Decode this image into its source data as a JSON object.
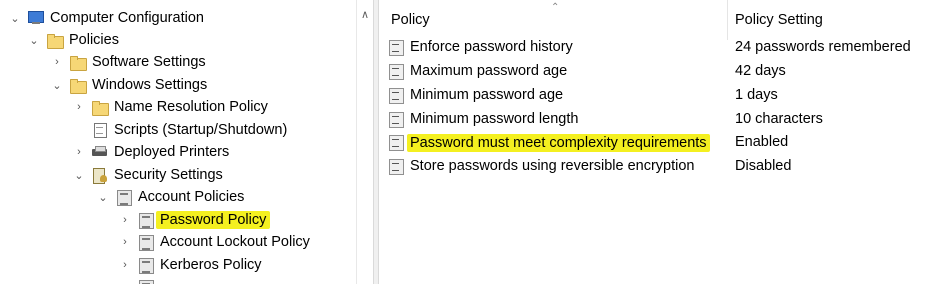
{
  "tree": {
    "nodes": [
      {
        "label": "Computer Configuration",
        "icon": "computer-icon",
        "expander": "expanded"
      },
      {
        "label": "Policies",
        "icon": "folder-icon",
        "expander": "expanded"
      },
      {
        "label": "Software Settings",
        "icon": "folder-icon",
        "expander": "collapsed"
      },
      {
        "label": "Windows Settings",
        "icon": "folder-icon",
        "expander": "expanded"
      },
      {
        "label": "Name Resolution Policy",
        "icon": "folder-icon",
        "expander": "collapsed"
      },
      {
        "label": "Scripts (Startup/Shutdown)",
        "icon": "script-icon",
        "expander": "none"
      },
      {
        "label": "Deployed Printers",
        "icon": "printer-icon",
        "expander": "collapsed"
      },
      {
        "label": "Security Settings",
        "icon": "security-settings-icon",
        "expander": "expanded"
      },
      {
        "label": "Account Policies",
        "icon": "policy-icon",
        "expander": "expanded"
      },
      {
        "label": "Password Policy",
        "icon": "policy-icon",
        "expander": "collapsed",
        "highlighted": true
      },
      {
        "label": "Account Lockout Policy",
        "icon": "policy-icon",
        "expander": "collapsed"
      },
      {
        "label": "Kerberos Policy",
        "icon": "policy-icon",
        "expander": "collapsed"
      }
    ]
  },
  "list": {
    "columns": [
      "Policy",
      "Policy Setting"
    ],
    "rows": [
      {
        "policy": "Enforce password history",
        "setting": "24 passwords remembered"
      },
      {
        "policy": "Maximum password age",
        "setting": "42 days"
      },
      {
        "policy": "Minimum password age",
        "setting": "1 days"
      },
      {
        "policy": "Minimum password length",
        "setting": "10 characters"
      },
      {
        "policy": "Password must meet complexity requirements",
        "setting": "Enabled",
        "highlighted": true
      },
      {
        "policy": "Store passwords using reversible encryption",
        "setting": "Disabled"
      }
    ]
  },
  "colors": {
    "highlight": "#f4f020"
  }
}
